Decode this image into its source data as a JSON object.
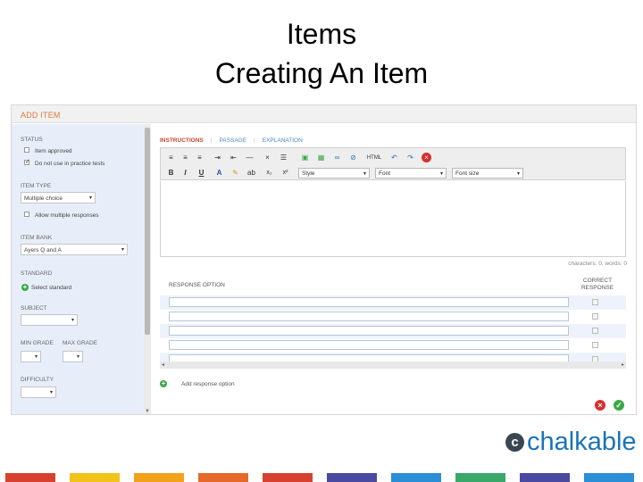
{
  "slide": {
    "title_line1": "Items",
    "title_line2": "Creating An Item"
  },
  "app": {
    "header_title": "ADD ITEM",
    "left": {
      "status_label": "STATUS",
      "item_approved": {
        "label": "Item approved",
        "checked": false
      },
      "practice_tests": {
        "label": "Do not use in practice tests",
        "checked": true
      },
      "item_type_label": "ITEM TYPE",
      "item_type_value": "Multiple choice",
      "allow_multiple": {
        "label": "Allow multiple responses",
        "checked": false
      },
      "item_bank_label": "ITEM BANK",
      "item_bank_value": "Ayers Q and A",
      "standard_label": "STANDARD",
      "select_standard": "Select standard",
      "subject_label": "SUBJECT",
      "min_grade_label": "MIN GRADE",
      "max_grade_label": "MAX GRADE",
      "difficulty_label": "DIFFICULTY"
    },
    "tabs": {
      "instructions": "INSTRUCTIONS",
      "passage": "PASSAGE",
      "explanation": "EXPLANATION",
      "separator": "|"
    },
    "toolbar": {
      "html_label": "HTML",
      "bold": "B",
      "italic": "I",
      "underline": "U",
      "font_color": "A",
      "subscript": "x₂",
      "superscript": "x²",
      "style_select": "Style",
      "font_select": "Font",
      "size_select": "Font size"
    },
    "counter": "characters: 0, words: 0",
    "responses": {
      "option_header": "RESPONSE OPTION",
      "correct_header_line1": "CORRECT",
      "correct_header_line2": "RESPONSE",
      "rows": [
        "",
        "",
        "",
        "",
        ""
      ]
    },
    "add_option": "Add response option"
  },
  "brand": {
    "logo_text": "chalkable",
    "logo_mark": "c"
  },
  "colors": {
    "accent_orange": "#e0793a",
    "tab_active": "#d0452f",
    "tab_link": "#4b86c6",
    "logo_blue": "#1a73b8",
    "stripes": [
      "#d6422f",
      "#f2c31a",
      "#f2a21a",
      "#e56a2a",
      "#d6422f",
      "#4a4aa0",
      "#2a8fd6",
      "#3aa86a",
      "#4a4aa0",
      "#2a8fd6"
    ]
  }
}
